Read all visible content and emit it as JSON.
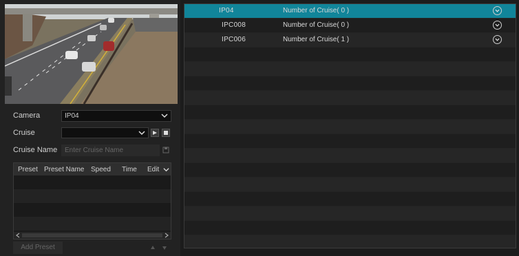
{
  "left_panel": {
    "camera_label": "Camera",
    "camera_value": "IP04",
    "cruise_label": "Cruise",
    "cruise_value": "",
    "cruise_name_label": "Cruise Name",
    "cruise_name_placeholder": "Enter Cruise Name",
    "table_headers": [
      "Preset",
      "Preset Name",
      "Speed",
      "Time",
      "Edit"
    ],
    "add_preset_label": "Add Preset"
  },
  "cruise_list": [
    {
      "camera": "IP04",
      "cruise": "Number of Cruise( 0 )",
      "selected": true
    },
    {
      "camera": "IPC008",
      "cruise": "Number of Cruise( 0 )",
      "selected": false
    },
    {
      "camera": "IPC006",
      "cruise": "Number of Cruise( 1 )",
      "selected": false
    }
  ],
  "colors": {
    "selection": "#11859a",
    "background": "#1c1c1c",
    "row_alt": "#1e1e1e"
  }
}
